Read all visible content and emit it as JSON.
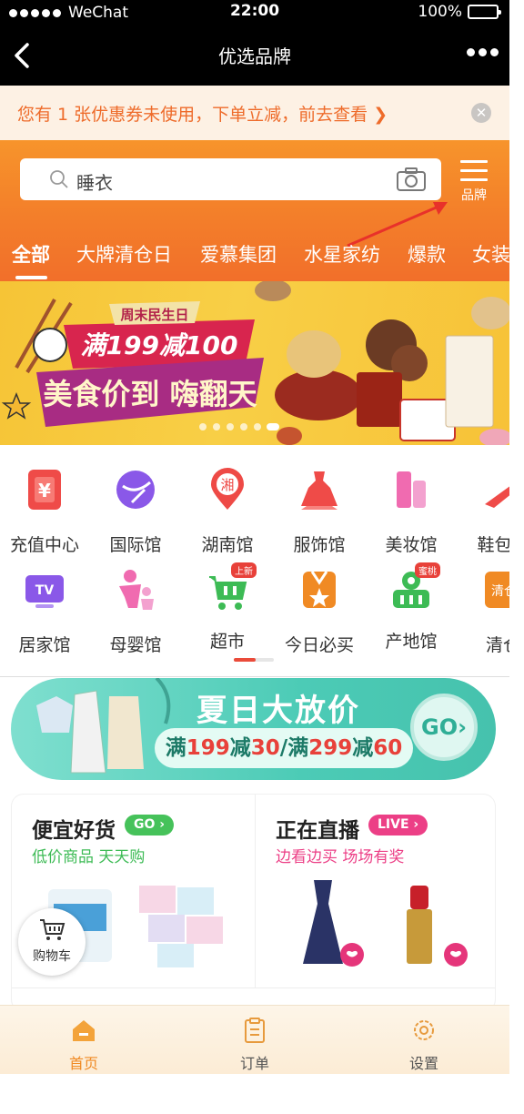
{
  "status_bar": {
    "carrier": "WeChat",
    "time": "22:00",
    "battery": "100%"
  },
  "nav": {
    "title": "优选品牌"
  },
  "notice": {
    "text": "您有 1 张优惠券未使用，下单立减，前去查看 ❯",
    "close": "✕"
  },
  "search": {
    "query": "睡衣"
  },
  "brand_button": {
    "label": "品牌"
  },
  "tabs": [
    {
      "label": "全部",
      "active": true
    },
    {
      "label": "大牌清仓日"
    },
    {
      "label": "爱慕集团"
    },
    {
      "label": "水星家纺"
    },
    {
      "label": "爆款"
    },
    {
      "label": "女装"
    }
  ],
  "banner": {
    "tag": "周末民生日",
    "headline": "满199减100",
    "slogan": "美食价到 嗨翻天"
  },
  "categories": [
    {
      "label": "充值中心",
      "icon": "recharge-icon",
      "color": "#ee4a46"
    },
    {
      "label": "国际馆",
      "icon": "globe-icon",
      "color": "#8a58e8"
    },
    {
      "label": "湖南馆",
      "icon": "hunan-pin-icon",
      "color": "#ee4a46",
      "glyph": "湘"
    },
    {
      "label": "服饰馆",
      "icon": "dress-icon",
      "color": "#ee4a46"
    },
    {
      "label": "美妆馆",
      "icon": "cosmetics-icon",
      "color": "#f06bb0"
    },
    {
      "label": "鞋包馆",
      "icon": "heel-icon",
      "color": "#ee4a46"
    },
    {
      "label": "居家馆",
      "icon": "tv-icon",
      "color": "#8a58e8",
      "glyph": "TV"
    },
    {
      "label": "母婴馆",
      "icon": "mother-baby-icon",
      "color": "#f06bb0"
    },
    {
      "label": "超市",
      "icon": "cart-icon",
      "color": "#3dbb55",
      "tag": "上新"
    },
    {
      "label": "今日必买",
      "icon": "badge-star-icon",
      "color": "#f08a24"
    },
    {
      "label": "产地馆",
      "icon": "basket-icon",
      "color": "#3dbb55",
      "tag": "蜜桃"
    },
    {
      "label": "清仓",
      "icon": "clearance-icon",
      "color": "#f08a24",
      "glyph": "清仓"
    }
  ],
  "promo": {
    "headline": "夏日大放价",
    "offer_prefix_1": "满",
    "offer_amt_1": "199",
    "offer_mid_1": "减",
    "offer_cut_1": "30",
    "offer_sep": "/",
    "offer_prefix_2": "满",
    "offer_amt_2": "299",
    "offer_mid_2": "减",
    "offer_cut_2": "60",
    "go": "GO›"
  },
  "cards": {
    "left": {
      "title": "便宜好货",
      "badge": "GO ›",
      "subtitle": "低价商品 天天购",
      "badge_color": "#46c25a",
      "sub_color": "#3dbb55"
    },
    "right": {
      "title": "正在直播",
      "badge": "LIVE ›",
      "subtitle": "边看边买 场场有奖",
      "badge_color": "#ec3f86",
      "sub_color": "#ec3f86"
    }
  },
  "cart": {
    "label": "购物车"
  },
  "tabbar": [
    {
      "label": "首页",
      "icon": "home-icon",
      "active": true
    },
    {
      "label": "订单",
      "icon": "order-icon"
    },
    {
      "label": "设置",
      "icon": "settings-icon"
    }
  ],
  "colors": {
    "accent": "#f37e2a",
    "notice_text": "#ee6b2a",
    "promo": "#4ccbb6"
  }
}
